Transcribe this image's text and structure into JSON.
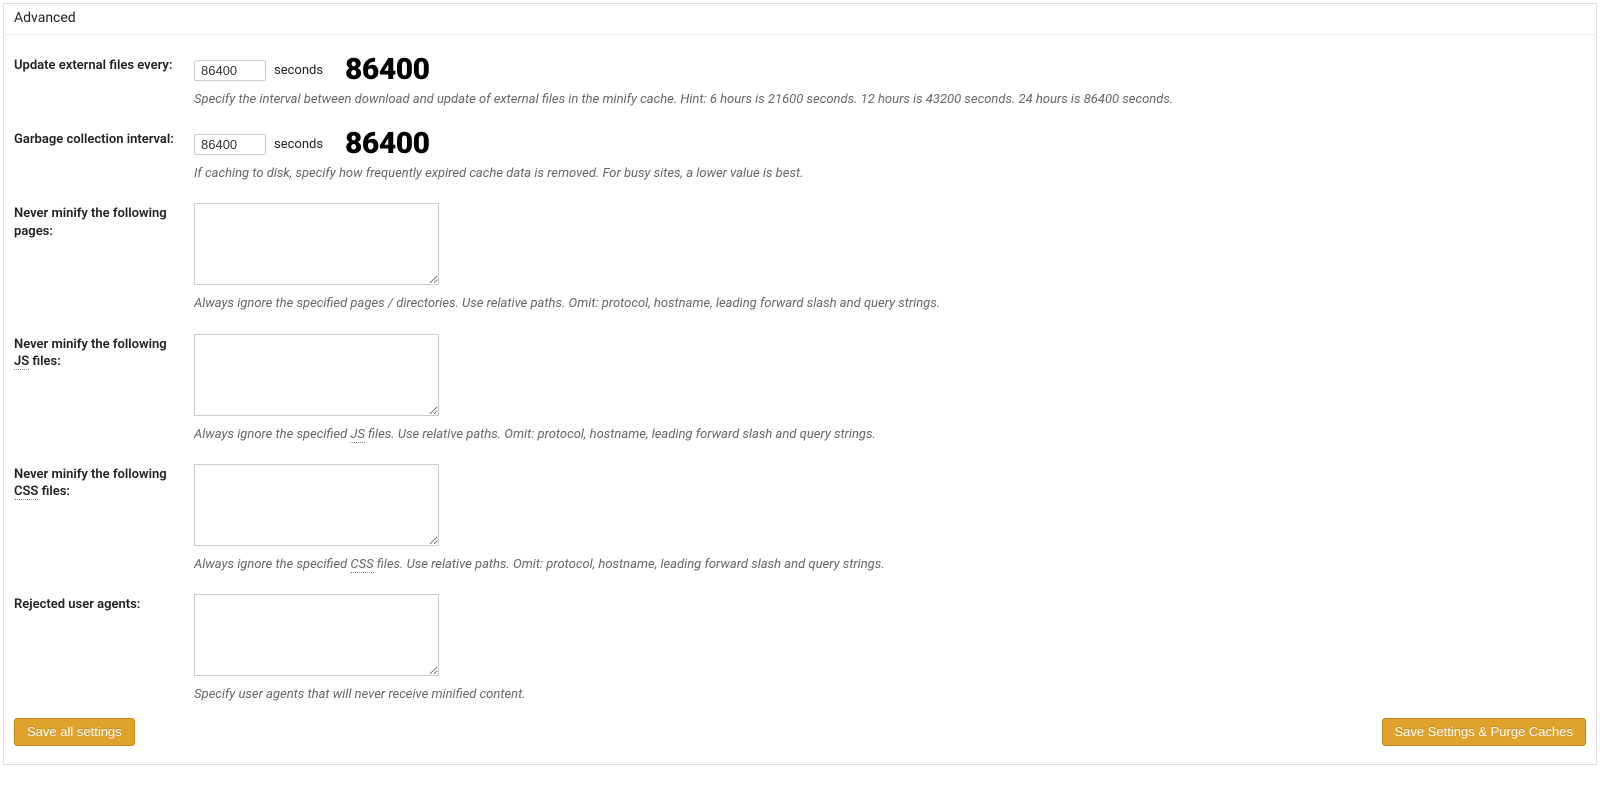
{
  "panel": {
    "title": "Advanced"
  },
  "fields": {
    "update_interval": {
      "label": "Update external files every:",
      "value": "86400",
      "unit": "seconds",
      "big": "86400",
      "desc": "Specify the interval between download and update of external files in the minify cache. Hint: 6 hours is 21600 seconds. 12 hours is 43200 seconds. 24 hours is 86400 seconds."
    },
    "gc_interval": {
      "label": "Garbage collection interval:",
      "value": "86400",
      "unit": "seconds",
      "big": "86400",
      "desc": "If caching to disk, specify how frequently expired cache data is removed. For busy sites, a lower value is best."
    },
    "never_pages": {
      "label": "Never minify the following pages:",
      "value": "",
      "desc": "Always ignore the specified pages / directories. Use relative paths. Omit: protocol, hostname, leading forward slash and query strings."
    },
    "never_js": {
      "label_pre": "Never minify the following ",
      "label_abbr": "JS",
      "label_post": " files:",
      "value": "",
      "desc_pre": "Always ignore the specified ",
      "desc_abbr": "JS",
      "desc_post": " files. Use relative paths. Omit: protocol, hostname, leading forward slash and query strings."
    },
    "never_css": {
      "label_pre": "Never minify the following ",
      "label_abbr": "CSS",
      "label_post": " files:",
      "value": "",
      "desc_pre": "Always ignore the specified ",
      "desc_abbr": "CSS",
      "desc_post": " files. Use relative paths. Omit: protocol, hostname, leading forward slash and query strings."
    },
    "rejected_ua": {
      "label": "Rejected user agents:",
      "value": "",
      "desc": "Specify user agents that will never receive minified content."
    }
  },
  "buttons": {
    "save_all": "Save all settings",
    "save_purge": "Save Settings & Purge Caches"
  }
}
